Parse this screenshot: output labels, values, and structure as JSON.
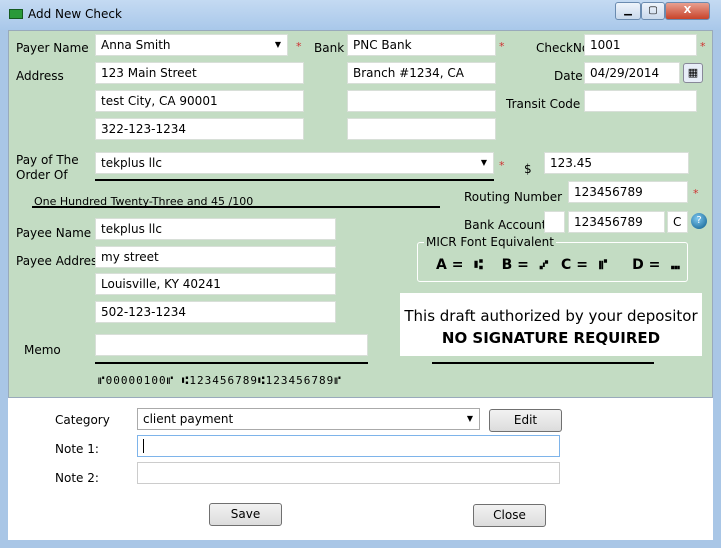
{
  "window": {
    "title": "Add New Check",
    "minimize": "▁",
    "maximize": "▢",
    "close": "X"
  },
  "payer": {
    "label": "Payer Name",
    "name": "Anna Smith",
    "address_label": "Address",
    "address1": "123 Main Street",
    "address2": "test City, CA 90001",
    "phone": "322-123-1234"
  },
  "bank": {
    "label": "Bank",
    "name": "PNC Bank",
    "branch": "Branch #1234, CA",
    "line3": "",
    "line4": ""
  },
  "check": {
    "no_label": "CheckNo",
    "no": "1001",
    "date_label": "Date",
    "date": "04/29/2014",
    "transit_label": "Transit Code",
    "transit": ""
  },
  "pay_to": {
    "label1": "Pay of The",
    "label2": "Order Of",
    "value": "tekplus llc",
    "dollar": "$",
    "amount": "123.45",
    "words": "One Hundred  Twenty-Three  and 45 /100"
  },
  "routing": {
    "label": "Routing Number",
    "value": "123456789"
  },
  "account": {
    "label": "Bank Account",
    "prefix": "",
    "value": "123456789",
    "suffix": "C"
  },
  "micr": {
    "legend": "MICR Font Equivalent",
    "a": "A =",
    "a_sym": "⑆",
    "b": "B =",
    "b_sym": "⑇",
    "c": "C =",
    "c_sym": "⑈",
    "d": "D =",
    "d_sym": "⑉",
    "line": "⑈00000100⑈ ⑆123456789⑆123456789⑈"
  },
  "payee": {
    "name_label": "Payee Name",
    "name": "tekplus llc",
    "address_label": "Payee Address",
    "address1": "my street",
    "address2": "Louisville, KY 40241",
    "phone": "502-123-1234"
  },
  "memo": {
    "label": "Memo",
    "value": ""
  },
  "auth": {
    "line1": "This draft authorized by your depositor",
    "line2": "NO SIGNATURE REQUIRED"
  },
  "lower": {
    "category_label": "Category",
    "category": "client payment",
    "edit": "Edit",
    "note1_label": "Note 1:",
    "note1": "",
    "note2_label": "Note 2:",
    "note2": "",
    "save": "Save",
    "close": "Close"
  },
  "colors": {
    "panel": "#c3dcc3",
    "required": "#d03030"
  }
}
